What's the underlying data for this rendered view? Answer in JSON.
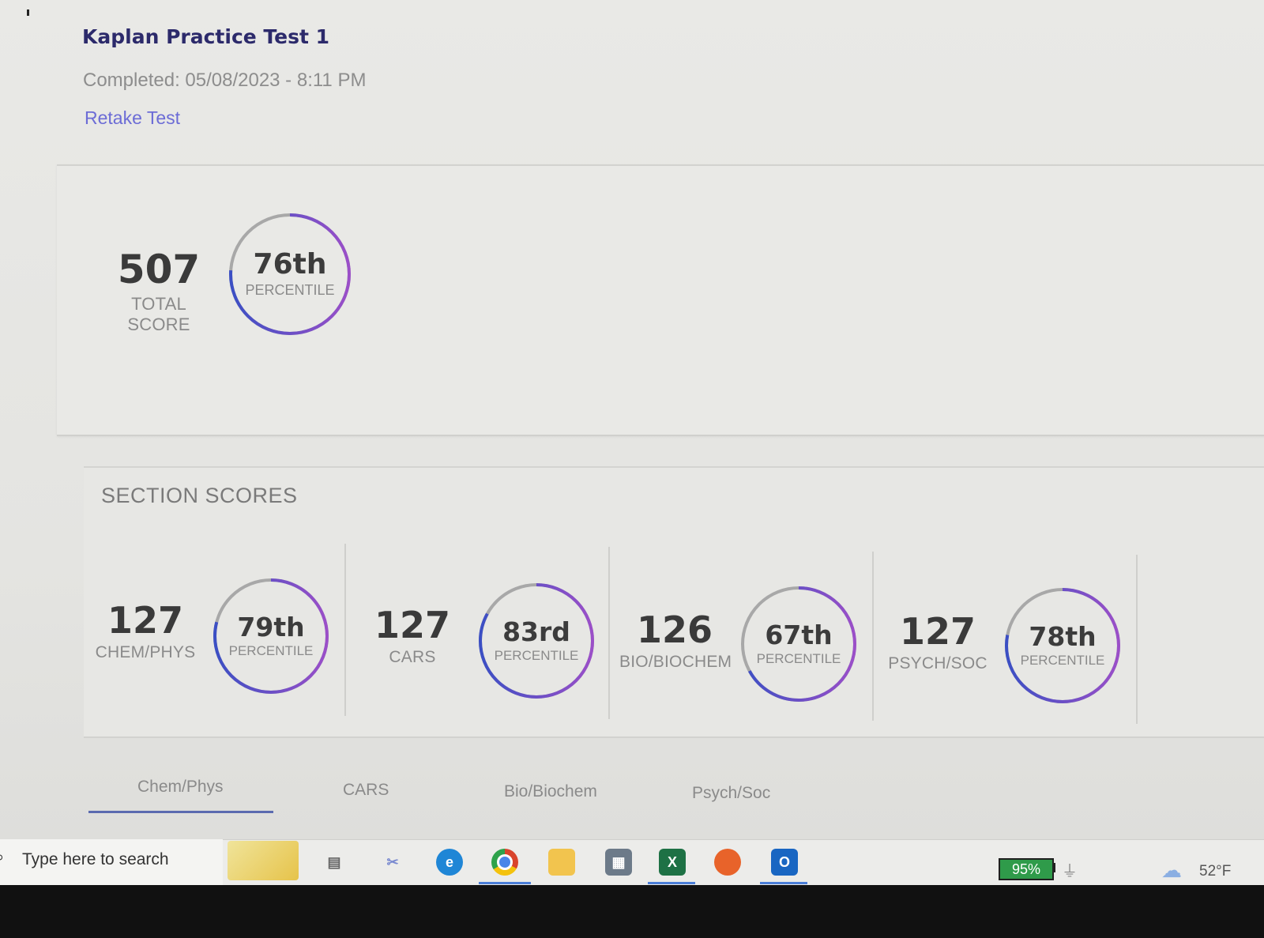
{
  "header": {
    "title": "Kaplan Practice Test 1",
    "completed": "Completed: 05/08/2023 - 8:11 PM",
    "retake_label": "Retake Test"
  },
  "total": {
    "score": "507",
    "score_label": "TOTAL SCORE",
    "percentile": "76th",
    "percentile_label": "PERCENTILE",
    "percentile_value": 76
  },
  "section_scores": {
    "title": "SECTION SCORES",
    "sections": [
      {
        "score": "127",
        "label": "CHEM/PHYS",
        "percentile": "79th",
        "percentile_label": "PERCENTILE",
        "percentile_value": 79
      },
      {
        "score": "127",
        "label": "CARS",
        "percentile": "83rd",
        "percentile_label": "PERCENTILE",
        "percentile_value": 83
      },
      {
        "score": "126",
        "label": "BIO/BIOCHEM",
        "percentile": "67th",
        "percentile_label": "PERCENTILE",
        "percentile_value": 67
      },
      {
        "score": "127",
        "label": "PSYCH/SOC",
        "percentile": "78th",
        "percentile_label": "PERCENTILE",
        "percentile_value": 78
      }
    ]
  },
  "tabs": [
    {
      "label": "Chem/Phys",
      "active": true
    },
    {
      "label": "CARS",
      "active": false
    },
    {
      "label": "Bio/Biochem",
      "active": false
    },
    {
      "label": "Psych/Soc",
      "active": false
    }
  ],
  "taskbar": {
    "search_placeholder": "Type here to search",
    "battery": "95%",
    "temperature": "52°F",
    "icons": [
      "task-view-icon",
      "snipping-tool-icon",
      "edge-icon",
      "chrome-icon",
      "file-explorer-icon",
      "calculator-icon",
      "excel-icon",
      "firefox-icon",
      "outlook-icon"
    ]
  },
  "colors": {
    "title": "#2c2a6b",
    "link": "#6c6cd6",
    "ring_gradient_start": "#3b4fc4",
    "ring_gradient_end": "#9b4fc8",
    "ring_track": "#a8a8a8"
  }
}
